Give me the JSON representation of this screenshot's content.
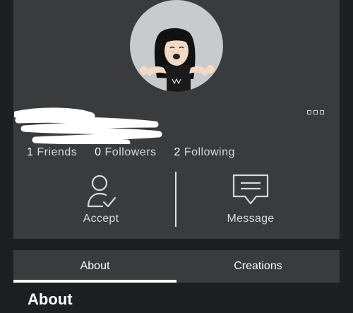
{
  "profile": {
    "stats": {
      "friends_count": "1",
      "friends_label": "Friends",
      "followers_count": "0",
      "followers_label": "Followers",
      "following_count": "2",
      "following_label": "Following"
    },
    "actions": {
      "accept_label": "Accept",
      "accept_icon": "person-check-icon",
      "message_label": "Message",
      "message_icon": "message-icon"
    },
    "more_icon": "more-options-icon"
  },
  "tabs": [
    {
      "label": "About",
      "active": true
    },
    {
      "label": "Creations",
      "active": false
    }
  ],
  "section": {
    "title": "About"
  },
  "colors": {
    "background": "#1e1f21",
    "card": "#393b3d",
    "avatar_bg": "#c9cacb",
    "text_primary": "#ffffff",
    "text_secondary": "#d8d8d8"
  }
}
